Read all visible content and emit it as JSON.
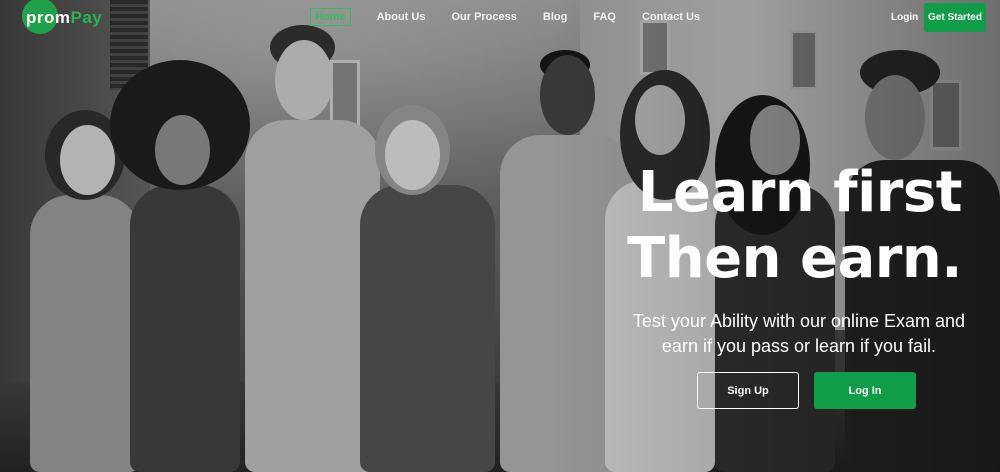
{
  "brand": {
    "logo_text_prefix": "prom",
    "logo_text_accent": "Pay",
    "accent_color": "#0f9d47"
  },
  "nav": {
    "items": [
      {
        "label": "Home",
        "active": true
      },
      {
        "label": "About Us",
        "active": false
      },
      {
        "label": "Our Process",
        "active": false
      },
      {
        "label": "Blog",
        "active": false
      },
      {
        "label": "FAQ",
        "active": false
      },
      {
        "label": "Contact Us",
        "active": false
      }
    ],
    "login_label": "Login",
    "cta_label": "Get Started"
  },
  "hero": {
    "headline_line1": "Learn first",
    "headline_line2": "Then earn.",
    "subtitle_line1": "Test your Ability with our online Exam and",
    "subtitle_line2": "earn if you pass or learn if you fail.",
    "signup_label": "Sign Up",
    "login_label": "Log In"
  }
}
